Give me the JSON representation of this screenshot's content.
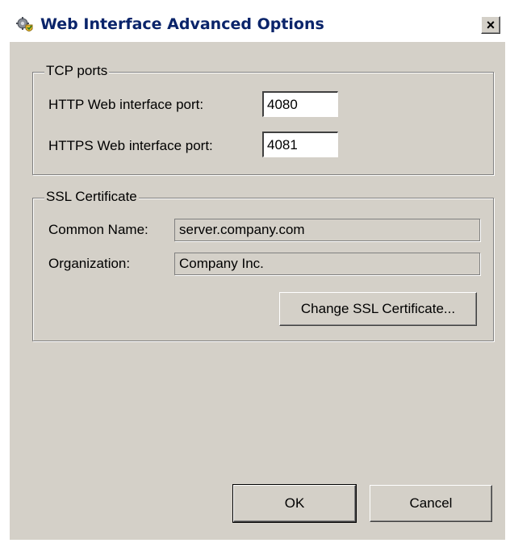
{
  "window": {
    "title": "Web Interface Advanced Options",
    "close_glyph": "×"
  },
  "tcp": {
    "legend": "TCP ports",
    "http_label": "HTTP Web interface port:",
    "http_value": "4080",
    "https_label": "HTTPS Web interface port:",
    "https_value": "4081"
  },
  "ssl": {
    "legend": "SSL Certificate",
    "common_name_label": "Common Name:",
    "common_name_value": "server.company.com",
    "organization_label": "Organization:",
    "organization_value": "Company Inc.",
    "change_button": "Change SSL Certificate..."
  },
  "footer": {
    "ok": "OK",
    "cancel": "Cancel"
  },
  "icons": {
    "app": "gear-shield-icon",
    "close": "close-icon"
  },
  "colors": {
    "title_text": "#0a246a",
    "dialog_bg": "#d4d0c8"
  }
}
